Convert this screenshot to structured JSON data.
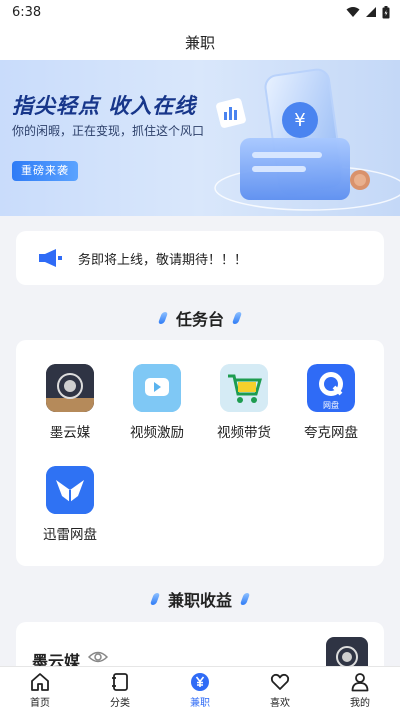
{
  "status_bar": {
    "time": "6:38"
  },
  "header": {
    "title": "兼职"
  },
  "banner": {
    "headline": "指尖轻点  收入在线",
    "subtitle": "你的闲暇，正在变现，抓住这个风口",
    "button_label": "重磅来袭",
    "coin_symbol": "¥"
  },
  "notice": {
    "text": "务即将上线，敬请期待！！！"
  },
  "task_section": {
    "title": "任务台",
    "items": [
      {
        "label": "墨云媒",
        "icon": "moyunmei-icon"
      },
      {
        "label": "视频激励",
        "icon": "video-play-icon"
      },
      {
        "label": "视频带货",
        "icon": "shopping-cart-icon"
      },
      {
        "label": "夸克网盘",
        "icon": "quark-disk-icon",
        "badge": "网盘"
      },
      {
        "label": "迅雷网盘",
        "icon": "xunlei-bird-icon"
      }
    ]
  },
  "income_section": {
    "title": "兼职收益",
    "card": {
      "name": "墨云媒"
    }
  },
  "bottom_nav": {
    "items": [
      {
        "label": "首页",
        "icon": "home-icon"
      },
      {
        "label": "分类",
        "icon": "category-icon"
      },
      {
        "label": "兼职",
        "icon": "yuan-icon",
        "active": true
      },
      {
        "label": "喜欢",
        "icon": "heart-icon"
      },
      {
        "label": "我的",
        "icon": "user-icon"
      }
    ]
  },
  "colors": {
    "accent": "#2f6bf6",
    "banner_title": "#17368a",
    "background": "#f2f3f7"
  }
}
